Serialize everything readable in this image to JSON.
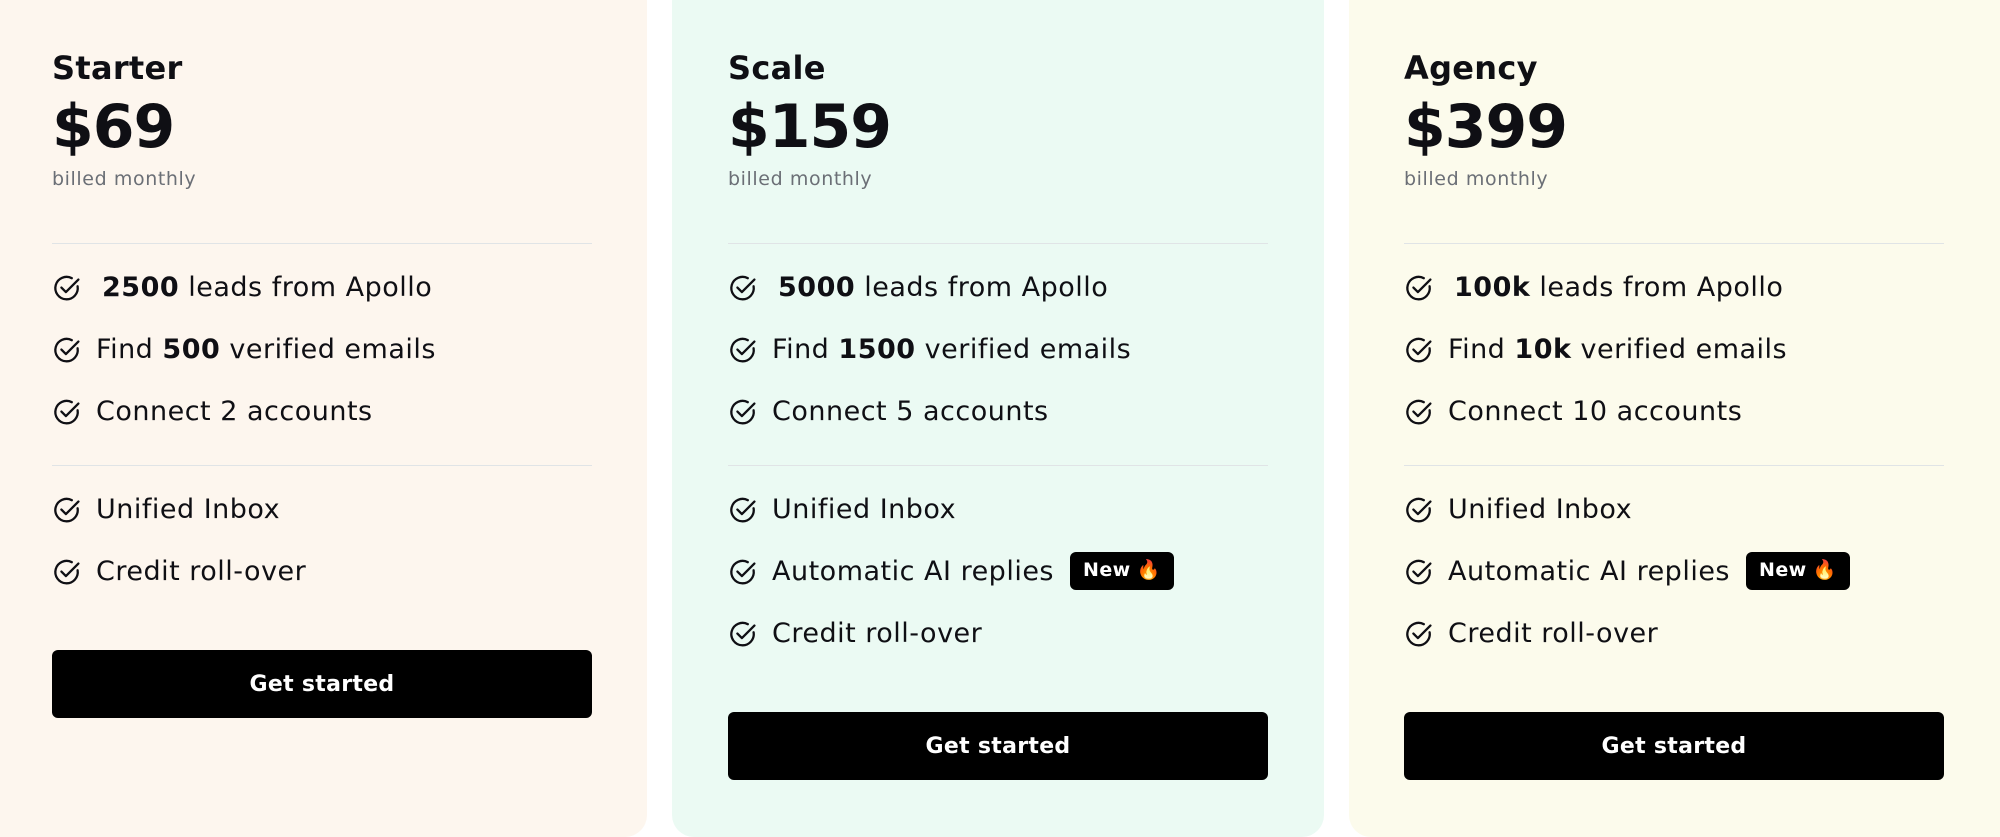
{
  "plans": [
    {
      "name": "Starter",
      "price": "$69",
      "billing": "billed monthly",
      "leads_value": "2500",
      "leads_suffix": "leads from Apollo",
      "emails_prefix": "Find",
      "emails_value": "500",
      "emails_suffix": "verified emails",
      "accounts": "Connect 2 accounts",
      "unified_inbox": "Unified Inbox",
      "credit": "Credit roll-over",
      "cta": "Get started"
    },
    {
      "name": "Scale",
      "price": "$159",
      "billing": "billed monthly",
      "leads_value": "5000",
      "leads_suffix": "leads from Apollo",
      "emails_prefix": "Find",
      "emails_value": "1500",
      "emails_suffix": "verified emails",
      "accounts": "Connect 5 accounts",
      "unified_inbox": "Unified Inbox",
      "ai_replies": "Automatic AI replies",
      "badge": "New",
      "credit": "Credit roll-over",
      "cta": "Get started"
    },
    {
      "name": "Agency",
      "price": "$399",
      "billing": "billed monthly",
      "leads_value": "100k",
      "leads_suffix": "leads from Apollo",
      "emails_prefix": "Find",
      "emails_value": "10k",
      "emails_suffix": "verified emails",
      "accounts": "Connect 10 accounts",
      "unified_inbox": "Unified Inbox",
      "ai_replies": "Automatic AI replies",
      "badge": "New",
      "credit": "Credit roll-over",
      "cta": "Get started"
    }
  ],
  "icons": {
    "feature": "check-circle-icon",
    "badge": "fire-icon"
  },
  "colors": {
    "starter_bg": "#fdf6ee",
    "scale_bg": "#ebfaf3",
    "agency_bg": "#fcfbec",
    "button": "#000000",
    "button_text": "#ffffff",
    "muted_text": "#6b6f76"
  }
}
